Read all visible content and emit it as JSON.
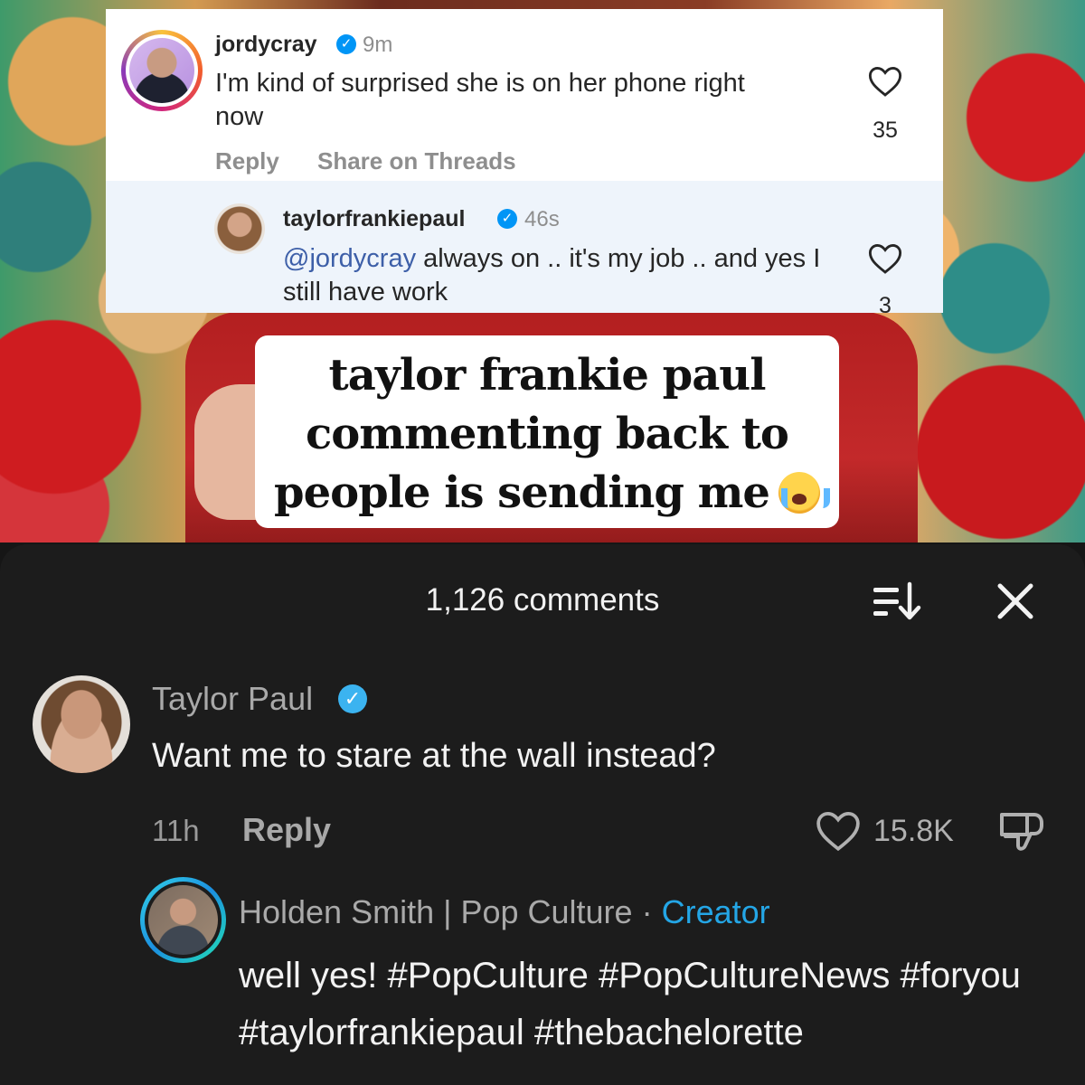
{
  "instagram_screenshot": {
    "comment": {
      "username": "jordycray",
      "time": "9m",
      "text": "I'm kind of surprised she is on her phone right now",
      "reply_label": "Reply",
      "share_label": "Share on Threads",
      "likes": "35"
    },
    "reply": {
      "username": "taylorfrankiepaul",
      "time": "46s",
      "mention": "@jordycray",
      "text": " always on .. it's my job .. and yes I still have work",
      "likes": "3"
    }
  },
  "caption": {
    "line1": "taylor frankie paul",
    "line2": "commenting back to",
    "line3": "people is sending me"
  },
  "sheet": {
    "title": "1,126 comments",
    "icons": {
      "sort": "sort-icon",
      "close": "close-icon"
    }
  },
  "comments": [
    {
      "name": "Taylor Paul",
      "verified": true,
      "text": "Want me to stare at the wall instead?",
      "time": "11h",
      "reply_label": "Reply",
      "likes": "15.8K"
    }
  ],
  "reply_comment": {
    "name": "Holden Smith | Pop Culture",
    "separator": " · ",
    "badge": "Creator",
    "text": "well yes! #PopCulture #PopCultureNews #foryou #taylorfrankiepaul #thebachelorette"
  },
  "colors": {
    "sheet_bg": "#1c1c1c",
    "verified_blue": "#3bb3f0",
    "creator_blue": "#24a6e6",
    "mention_blue": "#3d5fa8"
  }
}
